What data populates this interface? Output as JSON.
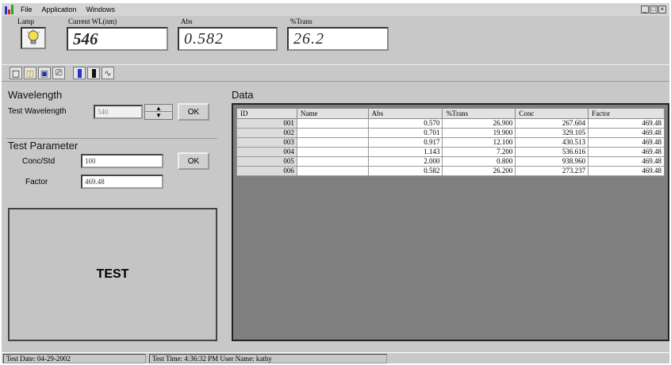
{
  "menu": {
    "items": [
      "File",
      "Application",
      "Windows"
    ],
    "window_controls": [
      "_",
      "□",
      "×"
    ]
  },
  "readouts": {
    "lamp_label": "Lamp",
    "wl_label": "Current WL(nm)",
    "wl_value": "546",
    "abs_label": "Abs",
    "abs_value": "0.582",
    "trans_label": "%Trans",
    "trans_value": "26.2"
  },
  "toolbar": {
    "icons": [
      "new-file-icon",
      "open-folder-icon",
      "save-icon",
      "print-icon",
      "blue-bar-icon",
      "black-bar-icon",
      "curve-icon"
    ]
  },
  "wavelength": {
    "title": "Wavelength",
    "test_wl_label": "Test Wavelength",
    "test_wl_value": "540",
    "ok_label": "OK"
  },
  "test_parameter": {
    "title": "Test Parameter",
    "conc_label": "Conc/Std",
    "conc_value": "100",
    "factor_label": "Factor",
    "factor_value": "469.48",
    "ok_label": "OK"
  },
  "test_button": {
    "label": "TEST"
  },
  "data": {
    "title": "Data",
    "columns": [
      "ID",
      "Name",
      "Abs",
      "%Trans",
      "Conc",
      "Factor"
    ],
    "rows": [
      [
        "001",
        "",
        "0.570",
        "26.900",
        "267.604",
        "469.48"
      ],
      [
        "002",
        "",
        "0.701",
        "19.900",
        "329.105",
        "469.48"
      ],
      [
        "003",
        "",
        "0.917",
        "12.100",
        "430.513",
        "469.48"
      ],
      [
        "004",
        "",
        "1.143",
        "7.200",
        "536.616",
        "469.48"
      ],
      [
        "005",
        "",
        "2.000",
        "0.800",
        "938.960",
        "469.48"
      ],
      [
        "006",
        "",
        "0.582",
        "26.200",
        "273.237",
        "469.48"
      ]
    ]
  },
  "status": {
    "test_date": "Test Date: 04-29-2002",
    "test_time_user": "Test Time: 4:36:32 PM  User Name: kathy"
  },
  "colors": {
    "accent_blue": "#2233cc",
    "lamp_yellow": "#f2e24a"
  }
}
